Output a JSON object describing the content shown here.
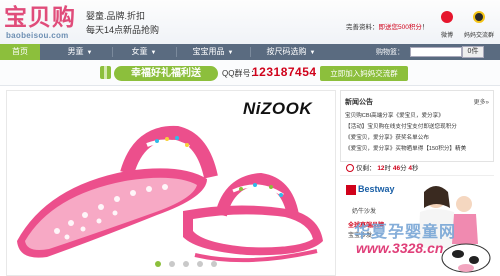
{
  "header": {
    "logo_text": "宝贝购",
    "logo_domain": "baobeisou.com",
    "slogan_line1": "婴童.品牌.折扣",
    "slogan_line2": "每天14点新品抢购",
    "register_prefix": "完善资料：",
    "register_highlight": "即送您500积分",
    "register_suffix": "！",
    "weibo_label": "微博",
    "qq_label": "妈妈交流群"
  },
  "nav": {
    "items": [
      {
        "label": "首页",
        "active": true,
        "dropdown": false
      },
      {
        "label": "男童",
        "active": false,
        "dropdown": true
      },
      {
        "label": "女童",
        "active": false,
        "dropdown": true
      },
      {
        "label": "宝宝用品",
        "active": false,
        "dropdown": true
      },
      {
        "label": "按尺码选购",
        "active": false,
        "dropdown": true
      }
    ],
    "cart_label": "购物篮：",
    "cart_count": "0",
    "cart_unit": "件"
  },
  "banner": {
    "title": "幸福好礼福利送",
    "qq_label": "QQ群号：",
    "qq_number": "123187454",
    "join_label": "立即加入妈妈交流群"
  },
  "hero": {
    "brand": "NiZOOK",
    "slide_count": 5,
    "active_slide": 0
  },
  "news": {
    "title": "新闻公告",
    "more": "更多»",
    "items": [
      "宝贝购CBI高端分享《爱宝贝，爱分享》",
      "【活动】宝贝购在线支付宝支付即送您现积分",
      "《爱宝贝，爱分享》获奖名单公布",
      "《爱宝贝，爱分享》买物晒单得【150积分】精美"
    ]
  },
  "countdown": {
    "label": "仅剩：",
    "hours": "12",
    "hours_unit": "时",
    "minutes": "46",
    "minutes_unit": "分",
    "seconds": "4",
    "seconds_unit": "秒"
  },
  "ad": {
    "brand": "Bestway",
    "line1": "奶牛沙发",
    "line2": "全球高端品牌",
    "line3": "宝宝沙发"
  },
  "watermark": {
    "line1": "华夏孕婴童网",
    "line2": "www.3328.cn"
  },
  "colors": {
    "brand_pink": "#e04c7a",
    "nav_bg": "#5a6b80",
    "accent_green": "#8cbf3c",
    "highlight_red": "#d0021b"
  }
}
